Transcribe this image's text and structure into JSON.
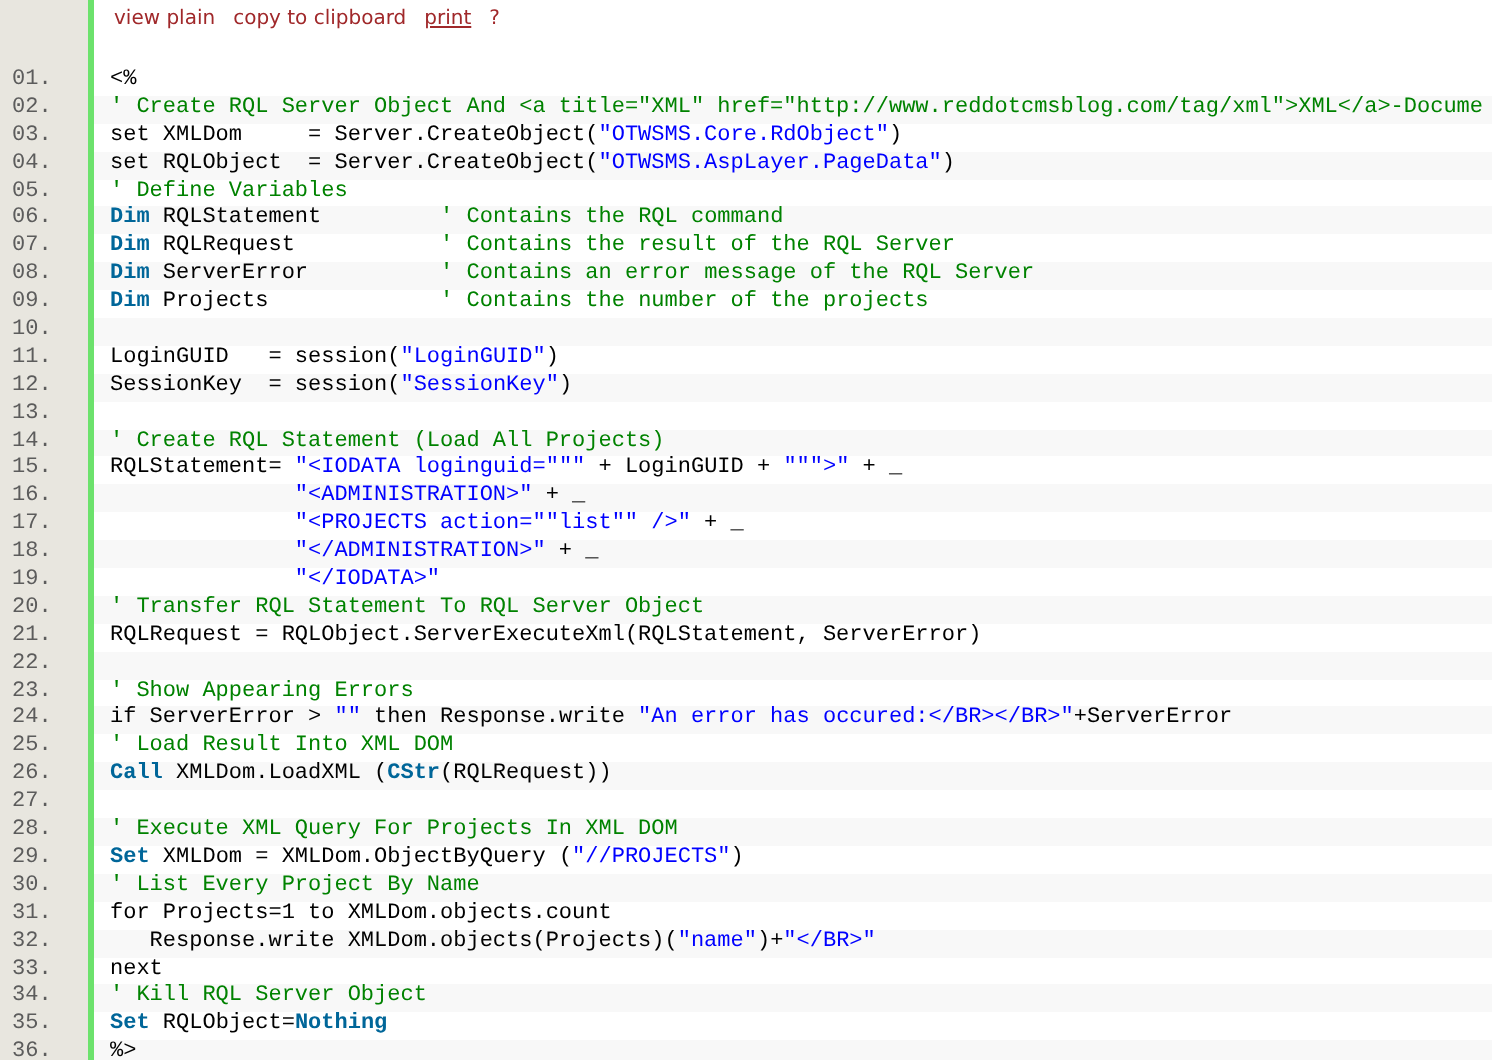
{
  "toolbar": [
    {
      "label": "view plain",
      "underlined": false
    },
    {
      "label": "copy to clipboard",
      "underlined": false
    },
    {
      "label": "print",
      "underlined": true
    },
    {
      "label": "?",
      "underlined": false
    }
  ],
  "lines": [
    {
      "number": "01.",
      "tokens": [
        {
          "kind": "plain",
          "text": "<%"
        }
      ]
    },
    {
      "number": "02.",
      "tokens": [
        {
          "kind": "comment",
          "text": "' Create RQL Server Object And <a title=\"XML\" href=\"http://www.reddotcmsblog.com/tag/xml\">XML</a>-Docume"
        }
      ]
    },
    {
      "number": "03.",
      "tokens": [
        {
          "kind": "plain",
          "text": "set XMLDom     = Server.CreateObject("
        },
        {
          "kind": "string",
          "text": "\"OTWSMS.Core.RdObject\""
        },
        {
          "kind": "plain",
          "text": ")"
        }
      ]
    },
    {
      "number": "04.",
      "tokens": [
        {
          "kind": "plain",
          "text": "set RQLObject  = Server.CreateObject("
        },
        {
          "kind": "string",
          "text": "\"OTWSMS.AspLayer.PageData\""
        },
        {
          "kind": "plain",
          "text": ")"
        }
      ]
    },
    {
      "number": "05.",
      "tokens": [
        {
          "kind": "comment",
          "text": "' Define Variables"
        }
      ]
    },
    {
      "number": "06.",
      "tokens": [
        {
          "kind": "keyword",
          "text": "Dim"
        },
        {
          "kind": "plain",
          "text": " RQLStatement         "
        },
        {
          "kind": "comment",
          "text": "' Contains the RQL command"
        }
      ]
    },
    {
      "number": "07.",
      "tokens": [
        {
          "kind": "keyword",
          "text": "Dim"
        },
        {
          "kind": "plain",
          "text": " RQLRequest           "
        },
        {
          "kind": "comment",
          "text": "' Contains the result of the RQL Server"
        }
      ]
    },
    {
      "number": "08.",
      "tokens": [
        {
          "kind": "keyword",
          "text": "Dim"
        },
        {
          "kind": "plain",
          "text": " ServerError          "
        },
        {
          "kind": "comment",
          "text": "' Contains an error message of the RQL Server"
        }
      ]
    },
    {
      "number": "09.",
      "tokens": [
        {
          "kind": "keyword",
          "text": "Dim"
        },
        {
          "kind": "plain",
          "text": " Projects             "
        },
        {
          "kind": "comment",
          "text": "' Contains the number of the projects"
        }
      ]
    },
    {
      "number": "10."
    },
    {
      "number": "11.",
      "tokens": [
        {
          "kind": "plain",
          "text": "LoginGUID   = session("
        },
        {
          "kind": "string",
          "text": "\"LoginGUID\""
        },
        {
          "kind": "plain",
          "text": ")"
        }
      ]
    },
    {
      "number": "12.",
      "tokens": [
        {
          "kind": "plain",
          "text": "SessionKey  = session("
        },
        {
          "kind": "string",
          "text": "\"SessionKey\""
        },
        {
          "kind": "plain",
          "text": ")"
        }
      ]
    },
    {
      "number": "13."
    },
    {
      "number": "14.",
      "tokens": [
        {
          "kind": "comment",
          "text": "' Create RQL Statement (Load All Projects)"
        }
      ]
    },
    {
      "number": "15.",
      "tokens": [
        {
          "kind": "plain",
          "text": "RQLStatement= "
        },
        {
          "kind": "string",
          "text": "\"<IODATA loginguid=\"\"\""
        },
        {
          "kind": "plain",
          "text": " + LoginGUID + "
        },
        {
          "kind": "string",
          "text": "\"\"\">\""
        },
        {
          "kind": "plain",
          "text": " + _"
        }
      ]
    },
    {
      "number": "16.",
      "indented": true,
      "tokens": [
        {
          "kind": "string",
          "text": "\"<ADMINISTRATION>\""
        },
        {
          "kind": "plain",
          "text": " + _"
        }
      ]
    },
    {
      "number": "17.",
      "indented": true,
      "tokens": [
        {
          "kind": "string",
          "text": "\"<PROJECTS action=\"\"list\"\" />\""
        },
        {
          "kind": "plain",
          "text": " + _"
        }
      ]
    },
    {
      "number": "18.",
      "indented": true,
      "tokens": [
        {
          "kind": "string",
          "text": "\"</ADMINISTRATION>\""
        },
        {
          "kind": "plain",
          "text": " + _"
        }
      ]
    },
    {
      "number": "19.",
      "indented": true,
      "tokens": [
        {
          "kind": "string",
          "text": "\"</IODATA>\""
        }
      ]
    },
    {
      "number": "20.",
      "tokens": [
        {
          "kind": "comment",
          "text": "' Transfer RQL Statement To RQL Server Object"
        }
      ]
    },
    {
      "number": "21.",
      "tokens": [
        {
          "kind": "plain",
          "text": "RQLRequest = RQLObject.ServerExecuteXml(RQLStatement, ServerError)"
        }
      ]
    },
    {
      "number": "22."
    },
    {
      "number": "23.",
      "tokens": [
        {
          "kind": "comment",
          "text": "' Show Appearing Errors"
        }
      ]
    },
    {
      "number": "24.",
      "tokens": [
        {
          "kind": "plain",
          "text": "if ServerError > "
        },
        {
          "kind": "string",
          "text": "\"\""
        },
        {
          "kind": "plain",
          "text": " then Response.write "
        },
        {
          "kind": "string",
          "text": "\"An error has occured:</BR></BR>\""
        },
        {
          "kind": "plain",
          "text": "+ServerError"
        }
      ]
    },
    {
      "number": "25.",
      "tokens": [
        {
          "kind": "comment",
          "text": "' Load Result Into XML DOM"
        }
      ]
    },
    {
      "number": "26.",
      "tokens": [
        {
          "kind": "keyword",
          "text": "Call"
        },
        {
          "kind": "plain",
          "text": " XMLDom.LoadXML ("
        },
        {
          "kind": "keyword",
          "text": "CStr"
        },
        {
          "kind": "plain",
          "text": "(RQLRequest))"
        }
      ]
    },
    {
      "number": "27."
    },
    {
      "number": "28.",
      "tokens": [
        {
          "kind": "comment",
          "text": "' Execute XML Query For Projects In XML DOM"
        }
      ]
    },
    {
      "number": "29.",
      "tokens": [
        {
          "kind": "keyword",
          "text": "Set"
        },
        {
          "kind": "plain",
          "text": " XMLDom = XMLDom.ObjectByQuery ("
        },
        {
          "kind": "string",
          "text": "\"//PROJECTS\""
        },
        {
          "kind": "plain",
          "text": ")"
        }
      ]
    },
    {
      "number": "30.",
      "tokens": [
        {
          "kind": "comment",
          "text": "' List Every Project By Name"
        }
      ]
    },
    {
      "number": "31.",
      "tokens": [
        {
          "kind": "plain",
          "text": "for Projects=1 to XMLDom.objects.count"
        }
      ]
    },
    {
      "number": "32.",
      "tokens": [
        {
          "kind": "plain",
          "text": "   Response.write XMLDom.objects(Projects)("
        },
        {
          "kind": "string",
          "text": "\"name\""
        },
        {
          "kind": "plain",
          "text": ")+"
        },
        {
          "kind": "string",
          "text": "\"</BR>\""
        }
      ]
    },
    {
      "number": "33.",
      "tokens": [
        {
          "kind": "plain",
          "text": "next"
        }
      ]
    },
    {
      "number": "34.",
      "tokens": [
        {
          "kind": "comment",
          "text": "' Kill RQL Server Object"
        }
      ]
    },
    {
      "number": "35.",
      "tokens": [
        {
          "kind": "keyword",
          "text": "Set"
        },
        {
          "kind": "plain",
          "text": " RQLObject="
        },
        {
          "kind": "keyword",
          "text": "Nothing"
        }
      ]
    },
    {
      "number": "36.",
      "tokens": [
        {
          "kind": "plain",
          "text": "%>"
        }
      ]
    }
  ]
}
